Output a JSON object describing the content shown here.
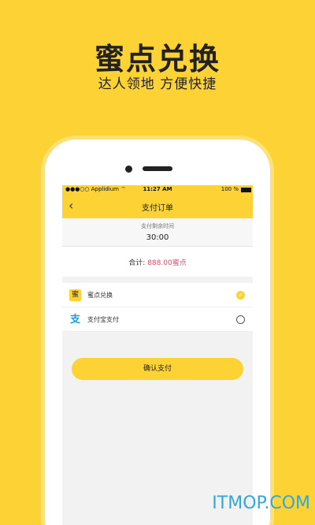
{
  "promo": {
    "title": "蜜点兑换",
    "subtitle": "达人领地  方便快捷"
  },
  "status_bar": {
    "carrier": "●●●○○ Applidium ⌔",
    "time": "11:27 AM",
    "battery": "100 %"
  },
  "nav": {
    "back_icon": "‹",
    "title": "支付订单"
  },
  "timer": {
    "label": "支付剩余时间",
    "value": "30:00"
  },
  "total": {
    "label": "合计: ",
    "amount": "888.00蜜点"
  },
  "payment_methods": [
    {
      "icon": "蜜",
      "icon_name": "honey-points-icon",
      "label": "蜜点兑换",
      "selected": true
    },
    {
      "icon": "支",
      "icon_name": "alipay-icon",
      "label": "支付宝支付",
      "selected": false
    }
  ],
  "confirm_button": "确认支付",
  "watermark": "ITMOP.COM",
  "colors": {
    "accent": "#FDD235",
    "amount": "#e5476c",
    "alipay": "#1d9de0",
    "watermark": "#2fa8dc"
  }
}
